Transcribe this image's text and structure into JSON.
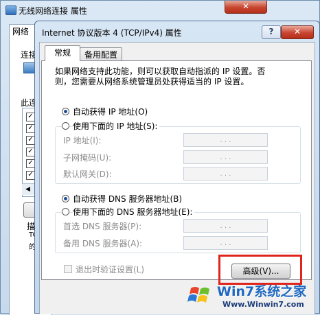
{
  "back_window": {
    "title": "无线网络连接 属性",
    "close_label": "✕",
    "tab_label": "网络",
    "connect_label": "连接",
    "this_label": "此连",
    "desc_label": "描",
    "desc_small": "TC",
    "desc_small2": "的"
  },
  "dialog": {
    "title": "Internet 协议版本 4 (TCP/IPv4) 属性",
    "help_label": "?",
    "close_label": "✕",
    "tabs": [
      {
        "label": "常规"
      },
      {
        "label": "备用配置"
      }
    ],
    "description": "如果网络支持此功能，则可以获取自动指派的 IP 设置。否则，您需要从网络系统管理员处获得适当的 IP 设置。",
    "ip": {
      "auto_label": "自动获得 IP 地址(O)",
      "manual_label": "使用下面的 IP 地址(S):",
      "address_label": "IP 地址(I):",
      "mask_label": "子网掩码(U):",
      "gateway_label": "默认网关(D):",
      "selected": "auto"
    },
    "dns": {
      "auto_label": "自动获得 DNS 服务器地址(B)",
      "manual_label": "使用下面的 DNS 服务器地址(E):",
      "preferred_label": "首选 DNS 服务器(P):",
      "alternate_label": "备用 DNS 服务器(A):",
      "selected": "auto"
    },
    "validate_label": "退出时验证设置(L)",
    "advanced_label": "高级(V)..."
  },
  "ip_dots": ".   .   .",
  "watermark": {
    "main": "Win7系统之家",
    "url": "Www.Winwin7.com"
  },
  "colors": {
    "highlight": "#e0241b",
    "accent": "#1b4f92"
  }
}
